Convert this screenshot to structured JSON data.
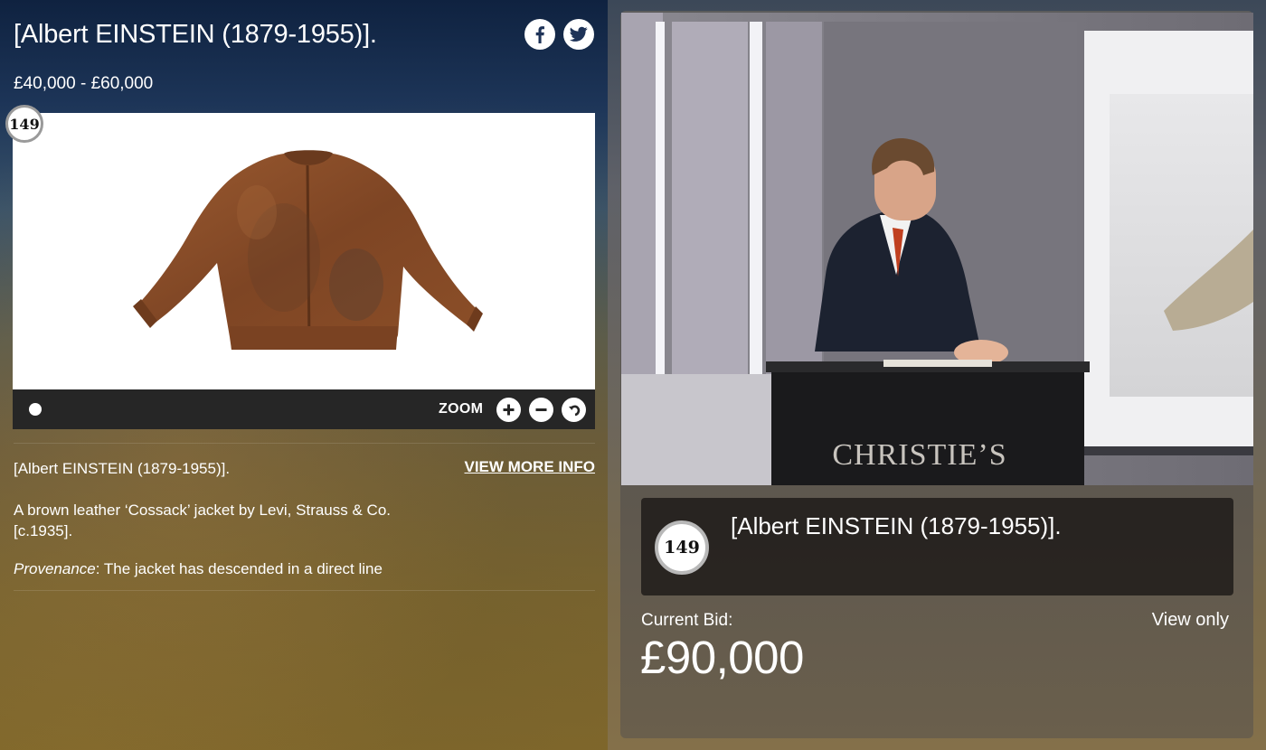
{
  "lot": {
    "number": "149",
    "title": "[Albert EINSTEIN (1879-1955)].",
    "estimate": "£40,000 - £60,000"
  },
  "social": {
    "facebook_icon": "facebook-icon",
    "twitter_icon": "twitter-icon"
  },
  "viewer": {
    "image_subject": "brown leather jacket",
    "zoom_label": "ZOOM",
    "controls": [
      "zoom-in-icon",
      "zoom-out-icon",
      "reset-icon"
    ]
  },
  "description": {
    "title": "[Albert EINSTEIN (1879-1955)].",
    "view_more": "VIEW MORE INFO",
    "body": "A brown leather ‘Cossack’ jacket by Levi, Strauss & Co. [c.1935].",
    "provenance_label": "Provenance",
    "provenance_text": ": The jacket has descended in a direct line"
  },
  "live": {
    "lot_number": "149",
    "title": "[Albert EINSTEIN (1879-1955)].",
    "current_bid_label": "Current Bid:",
    "current_bid": "£90,000",
    "mode": "View only",
    "podium_text": "CHRISTIE’S"
  },
  "colors": {
    "jacket": "#8a4a26",
    "badge_border": "#9a9a9a",
    "viewer_bar": "#262626"
  }
}
